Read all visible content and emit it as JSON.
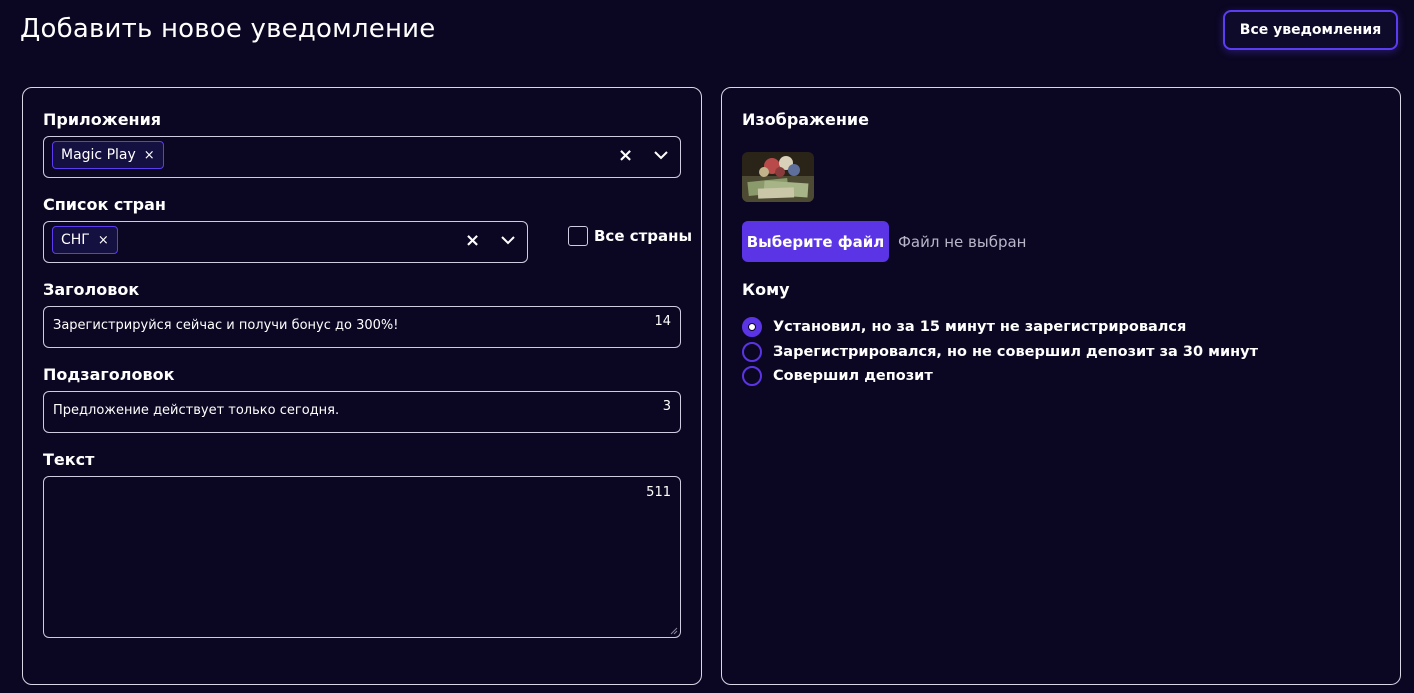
{
  "header": {
    "title": "Добавить новое уведомление",
    "all_notifications_button": "Все уведомления"
  },
  "left": {
    "apps": {
      "label": "Приложения",
      "chips": [
        "Magic Play"
      ],
      "chip_remove": "×",
      "clear": "×"
    },
    "countries": {
      "label": "Список стран",
      "chips": [
        "СНГ"
      ],
      "chip_remove": "×",
      "clear": "×",
      "all_countries_checkbox": {
        "label": "Все страны",
        "checked": false
      }
    },
    "title_field": {
      "label": "Заголовок",
      "value": "Зарегистрируйся сейчас и получи бонус до 300%!",
      "counter": "14"
    },
    "subtitle_field": {
      "label": "Подзаголовок",
      "value": "Предложение действует только сегодня.",
      "counter": "3"
    },
    "text_field": {
      "label": "Текст",
      "value": "",
      "counter": "511"
    }
  },
  "right": {
    "image": {
      "label": "Изображение",
      "choose_file_button": "Выберите файл",
      "file_status": "Файл не выбран"
    },
    "audience": {
      "label": "Кому",
      "options": [
        {
          "label": "Установил, но за 15 минут не зарегистрировался",
          "checked": true
        },
        {
          "label": "Зарегистрировался, но не совершил депозит за 30 минут",
          "checked": false
        },
        {
          "label": "Совершил депозит",
          "checked": false
        }
      ]
    }
  },
  "colors": {
    "background": "#0b0722",
    "accent": "#5b34e6",
    "border": "#cfcbe0"
  }
}
